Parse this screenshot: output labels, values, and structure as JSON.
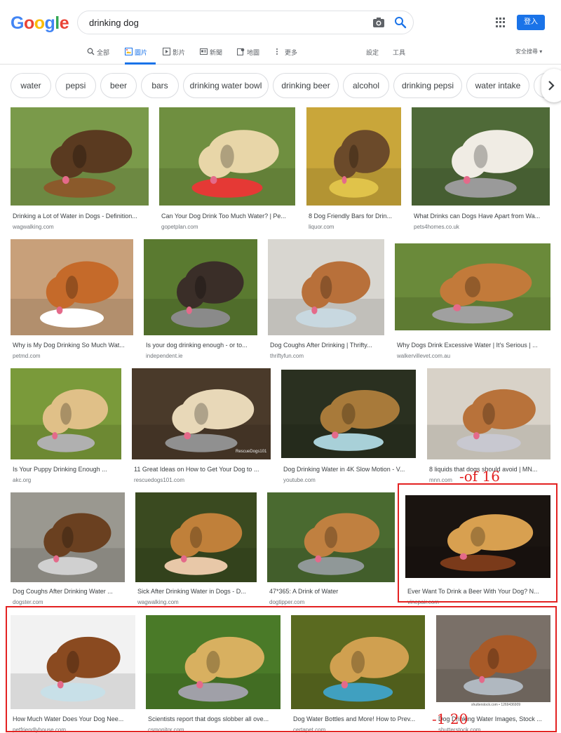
{
  "header": {
    "logo_letters": [
      "G",
      "o",
      "o",
      "g",
      "l",
      "e"
    ],
    "logo_colors": [
      "#4285f4",
      "#ea4335",
      "#fbbc05",
      "#4285f4",
      "#34a853",
      "#ea4335"
    ],
    "search_value": "drinking dog",
    "signin_label": "登入",
    "tabs": [
      {
        "label": "全部",
        "icon": "search-icon"
      },
      {
        "label": "圖片",
        "icon": "image-icon"
      },
      {
        "label": "影片",
        "icon": "video-icon"
      },
      {
        "label": "新聞",
        "icon": "news-icon"
      },
      {
        "label": "地圖",
        "icon": "map-icon"
      },
      {
        "label": "更多",
        "icon": "more-vert-icon"
      }
    ],
    "settings_label": "設定",
    "tools_label": "工具",
    "safesearch_label": "安全搜尋 ▾"
  },
  "colors": {
    "accent": "#1a73e8",
    "annotation": "#e32222"
  },
  "chips": [
    "water",
    "pepsi",
    "beer",
    "bars",
    "drinking water bowl",
    "drinking beer",
    "alcohol",
    "drinking pepsi",
    "water intake"
  ],
  "results": [
    {
      "title": "Drinking a Lot of Water in Dogs - Definition...",
      "source": "wagwalking.com",
      "bg": "#7a9a4a",
      "fg": "#5a3a20",
      "accent": "#8b5a2b"
    },
    {
      "title": "Can Your Dog Drink Too Much Water? | Pe...",
      "source": "gopetplan.com",
      "bg": "#6f8f40",
      "fg": "#e8d6a8",
      "accent": "#e53935"
    },
    {
      "title": "8 Dog Friendly Bars for Drin...",
      "source": "liquor.com",
      "bg": "#c9a63a",
      "fg": "#6b4a2a",
      "accent": "#e0c34a"
    },
    {
      "title": "What Drinks can Dogs Have Apart from Wa...",
      "source": "pets4homes.co.uk",
      "bg": "#4f6a38",
      "fg": "#f0ece4",
      "accent": "#9a9a9a"
    },
    {
      "title": "Why is My Dog Drinking So Much Wat...",
      "source": "petmd.com",
      "bg": "#c8a07a",
      "fg": "#c56a2a",
      "accent": "#ffffff"
    },
    {
      "title": "Is your dog drinking enough - or to...",
      "source": "independent.ie",
      "bg": "#5a7a30",
      "fg": "#3a2e28",
      "accent": "#8a8a8a"
    },
    {
      "title": "Dog Coughs After Drinking | Thrifty...",
      "source": "thriftyfun.com",
      "bg": "#d8d6d0",
      "fg": "#b8703a",
      "accent": "#c8d8e0"
    },
    {
      "title": "Why Dogs Drink Excessive Water | It's Serious | ...",
      "source": "walkervillevet.com.au",
      "bg": "#6a8a3a",
      "fg": "#c27a3a",
      "accent": "#a0a0a0"
    },
    {
      "title": "Is Your Puppy Drinking Enough ...",
      "source": "akc.org",
      "bg": "#7a9a3a",
      "fg": "#e0c088",
      "accent": "#b0b0b0"
    },
    {
      "title": "11 Great Ideas on How to Get Your Dog to ...",
      "source": "rescuedogs101.com",
      "bg": "#4a3a2a",
      "fg": "#e8d8b8",
      "accent": "#909090"
    },
    {
      "title": "Dog Drinking Water in 4K Slow Motion - V...",
      "source": "youtube.com",
      "bg": "#2a3020",
      "fg": "#a87a3a",
      "accent": "#a8d0d8"
    },
    {
      "title": "8 liquids that dogs should avoid | MN...",
      "source": "mnn.com",
      "bg": "#d8d2c8",
      "fg": "#b8723a",
      "accent": "#c8c8d0"
    },
    {
      "title": "Dog Coughs After Drinking Water ...",
      "source": "dogster.com",
      "bg": "#9a9890",
      "fg": "#6a4020",
      "accent": "#d0d0d0"
    },
    {
      "title": "Sick After Drinking Water in Dogs - D...",
      "source": "wagwalking.com",
      "bg": "#3a4a20",
      "fg": "#c0803a",
      "accent": "#e8c8a8"
    },
    {
      "title": "47*365: A Drink of Water",
      "source": "dogtipper.com",
      "bg": "#4a6a30",
      "fg": "#c08040",
      "accent": "#909898"
    },
    {
      "title": "Ever Want To Drink a Beer With Your Dog? N...",
      "source": "vinepair.com",
      "bg": "#1a1410",
      "fg": "#d8a050",
      "accent": "#7a3a1a"
    },
    {
      "title": "How Much Water Does Your Dog Nee...",
      "source": "petfriendlyhouse.com",
      "bg": "#f2f2f2",
      "fg": "#8a4a20",
      "accent": "#c8e0e8"
    },
    {
      "title": "Scientists report that dogs slobber all ove...",
      "source": "csmonitor.com",
      "bg": "#4a7a28",
      "fg": "#d8b060",
      "accent": "#a0a0a8"
    },
    {
      "title": "Dog Water Bottles and More! How to Prev...",
      "source": "certapet.com",
      "bg": "#5a6a20",
      "fg": "#d0a050",
      "accent": "#40a0c0"
    },
    {
      "title": "Dog Drinking Water Images, Stock ...",
      "source": "shutterstock.com",
      "bg": "#7a7068",
      "fg": "#a85a28",
      "accent": "#b0b8c0"
    }
  ],
  "watermarks": {
    "rescue": "RescueDogs101",
    "shutterstock": "shutterstock.com • 1269436909"
  },
  "annotations": [
    {
      "text": "-of 16"
    },
    {
      "text": "-1 20"
    }
  ]
}
